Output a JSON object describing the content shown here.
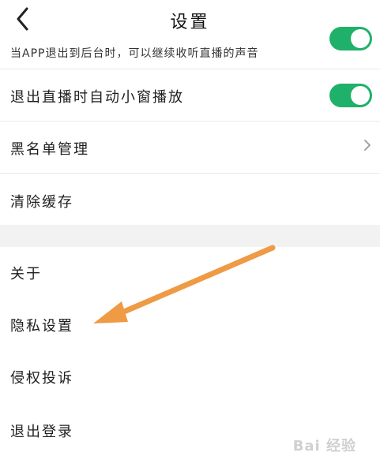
{
  "header": {
    "title": "设置",
    "back_icon": "chevron-left-icon"
  },
  "settings": {
    "background_play_desc": "当APP退出到后台时，可以继续收听直播的声音",
    "mini_window_label": "退出直播时自动小窗播放",
    "mini_window_toggle_on": true,
    "blacklist_label": "黑名单管理",
    "clear_cache_label": "清除缓存",
    "about_label": "关于",
    "privacy_label": "隐私设置",
    "complaint_label": "侵权投诉",
    "logout_label": "退出登录"
  },
  "watermark": {
    "text": "Bai 经验"
  },
  "colors": {
    "toggle_on": "#1fb16a",
    "arrow": "#ef9a45"
  }
}
